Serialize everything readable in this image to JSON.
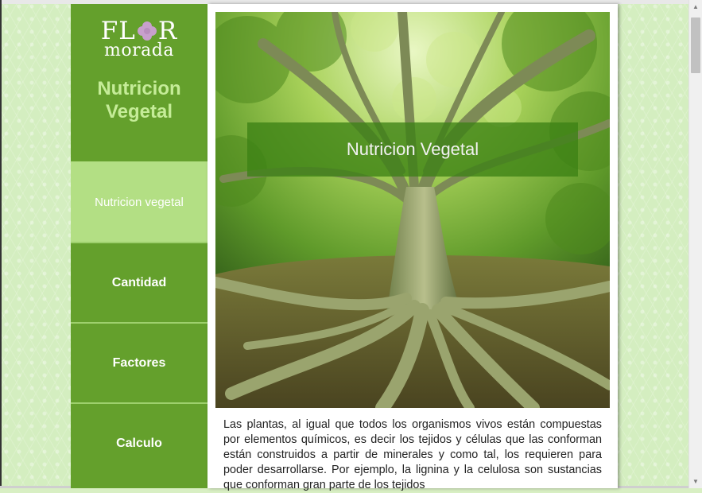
{
  "logo": {
    "line1_left": "FL",
    "line1_right": "R",
    "line2": "morada"
  },
  "sidebar": {
    "title": "Nutricion Vegetal",
    "items": [
      {
        "label": "Nutricion vegetal",
        "active": true
      },
      {
        "label": "Cantidad",
        "active": false
      },
      {
        "label": "Factores",
        "active": false
      },
      {
        "label": "Calculo",
        "active": false
      }
    ]
  },
  "hero": {
    "banner_title": "Nutricion Vegetal"
  },
  "article": {
    "paragraph": "Las plantas, al igual que todos los organismos vivos están compuestas por elementos químicos, es decir los tejidos y células que las conforman están construidos a partir de minerales y como tal, los requieren para poder desarrollarse. Por ejemplo, la lignina y la celulosa son sustancias que conforman gran parte de los tejidos"
  },
  "colors": {
    "sidebar_bg": "#64a02c",
    "nav_active_bg": "#b3df84",
    "title_color": "#c5ec98",
    "page_bg": "#d4eec0",
    "flower": "#c8a0cc"
  }
}
